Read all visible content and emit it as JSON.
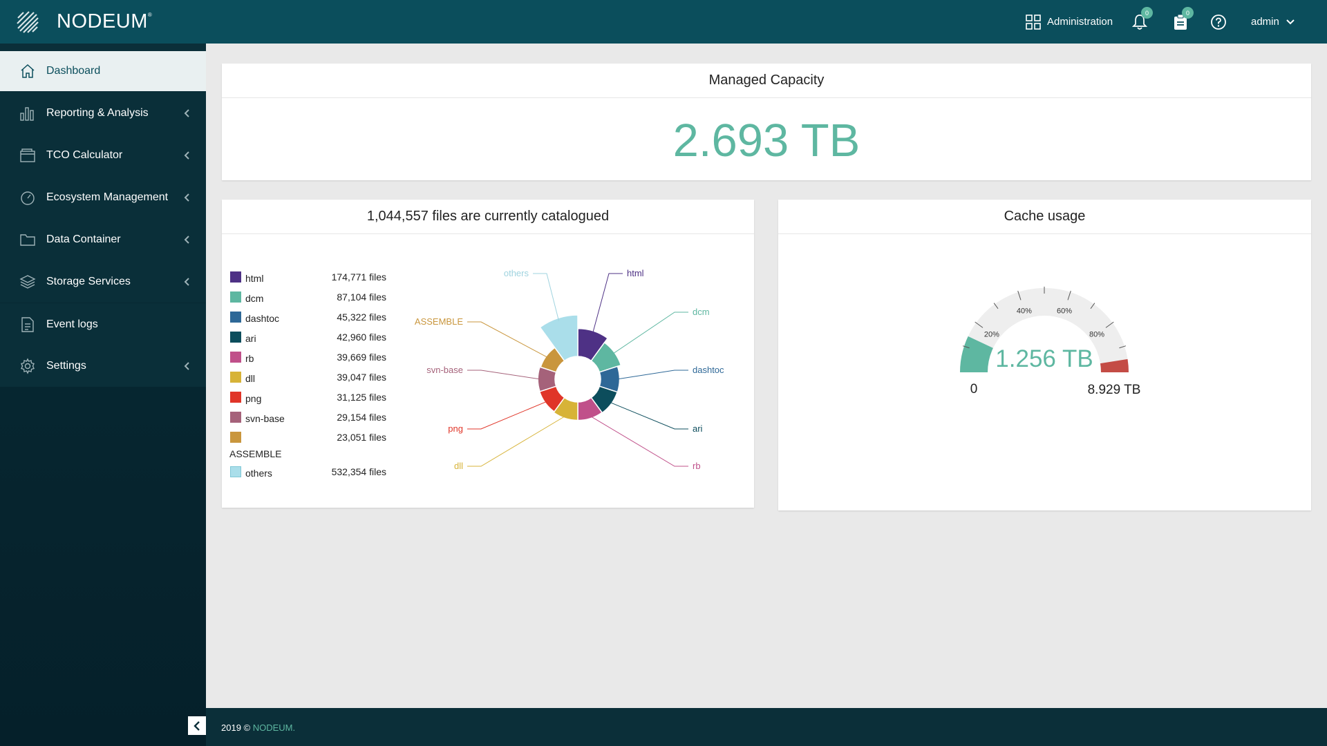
{
  "topbar": {
    "brand": "NODEUM",
    "admin_label": "Administration",
    "notifications_count": "0",
    "tasks_count": "0",
    "user_label": "admin"
  },
  "sidebar": {
    "items": [
      {
        "label": "Dashboard",
        "icon": "home-icon"
      },
      {
        "label": "Reporting & Analysis",
        "icon": "bar-chart-icon"
      },
      {
        "label": "TCO Calculator",
        "icon": "wallet-icon"
      },
      {
        "label": "Ecosystem Management",
        "icon": "gauge-icon"
      },
      {
        "label": "Data Container",
        "icon": "folder-icon"
      },
      {
        "label": "Storage Services",
        "icon": "layers-icon"
      },
      {
        "label": "Event logs",
        "icon": "document-icon"
      },
      {
        "label": "Settings",
        "icon": "gear-icon"
      }
    ]
  },
  "capacity": {
    "title": "Managed Capacity",
    "value": "2.693 TB"
  },
  "files": {
    "title": "1,044,557 files are currently catalogued"
  },
  "cache": {
    "title": "Cache usage",
    "value": "1.256 TB",
    "min_label": "0",
    "max_label": "8.929 TB",
    "ticks": [
      "20%",
      "40%",
      "60%",
      "80%"
    ]
  },
  "footer": {
    "text": "2019 © ",
    "brand": "NODEUM."
  },
  "chart_data": [
    {
      "type": "pie",
      "title": "1,044,557 files are currently catalogued",
      "categories": [
        "html",
        "dcm",
        "dashtoc",
        "ari",
        "rb",
        "dll",
        "png",
        "svn-base",
        "ASSEMBLE",
        "others"
      ],
      "values": [
        174771,
        87104,
        45322,
        42960,
        39669,
        39047,
        31125,
        29154,
        23051,
        532354
      ],
      "value_labels": [
        "174,771 files",
        "87,104 files",
        "45,322 files",
        "42,960 files",
        "39,669 files",
        "39,047 files",
        "31,125 files",
        "29,154 files",
        "23,051 files",
        "532,354 files"
      ],
      "colors": [
        "#4e3185",
        "#5eb7a1",
        "#2e6897",
        "#0c4d5c",
        "#c0508a",
        "#d7b338",
        "#e03528",
        "#a5627a",
        "#c9963d",
        "#aadeea"
      ],
      "legend": "left"
    },
    {
      "type": "gauge",
      "title": "Cache usage",
      "value": 1.256,
      "min": 0,
      "max": 8.929,
      "unit": "TB",
      "ticks": [
        "20%",
        "40%",
        "60%",
        "80%"
      ],
      "colors": {
        "value": "#5eb7a1",
        "track": "#eeeeee",
        "high": "#c44c45"
      }
    }
  ]
}
